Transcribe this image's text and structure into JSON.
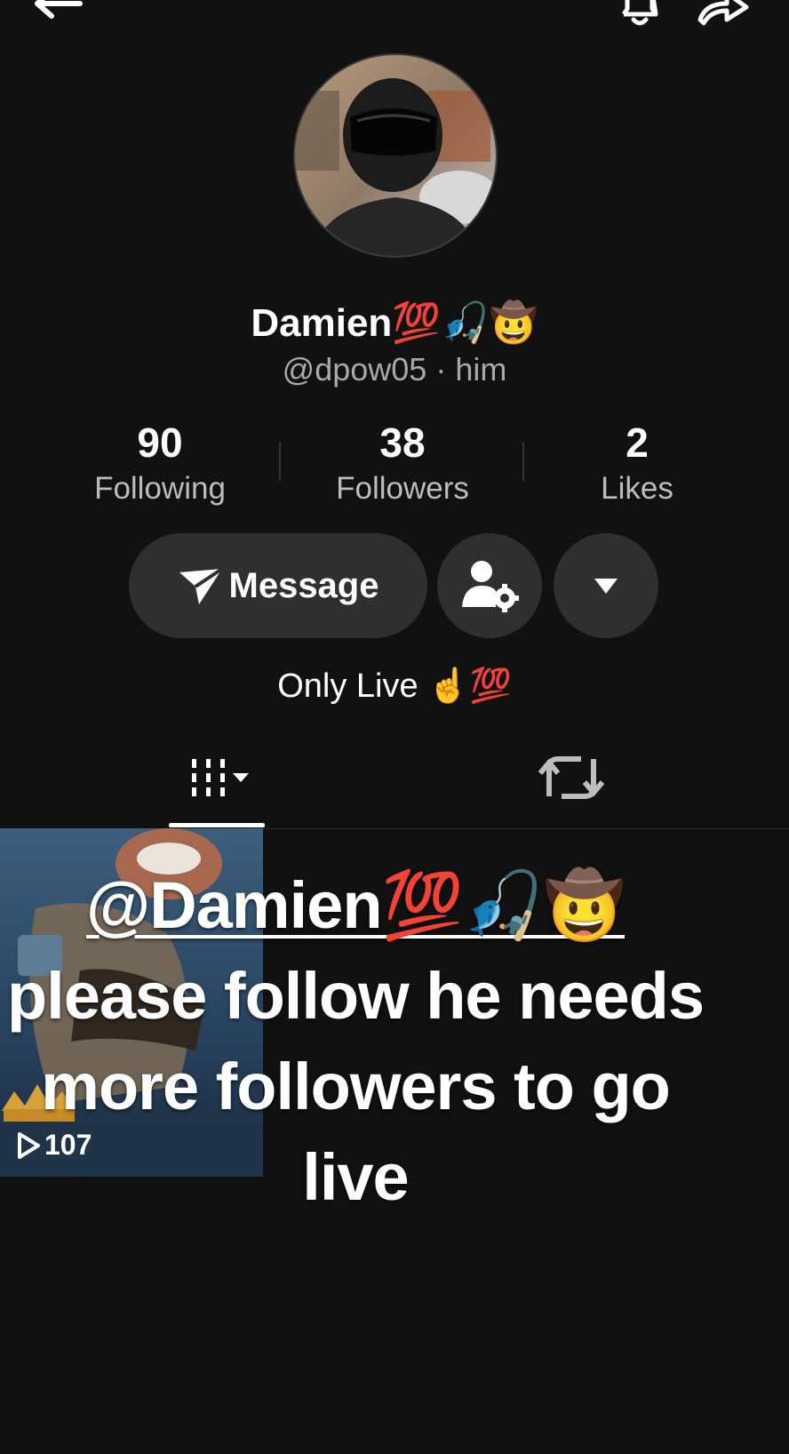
{
  "header": {
    "back_icon": "arrow-left-icon",
    "bell_icon": "bell-icon",
    "share_icon": "share-arrow-icon"
  },
  "profile": {
    "display_name": "Damien💯🎣🤠",
    "handle_line": "@dpow05 · him",
    "bio": "Only Live ☝️💯"
  },
  "stats": [
    {
      "value": "90",
      "label": "Following"
    },
    {
      "value": "38",
      "label": "Followers"
    },
    {
      "value": "2",
      "label": "Likes"
    }
  ],
  "actions": {
    "message_label": "Message",
    "message_icon": "paper-plane-icon",
    "profile_settings_icon": "person-gear-icon",
    "more_icon": "caret-down-icon"
  },
  "tabs": {
    "videos_icon": "video-grid-icon",
    "reposts_icon": "repost-icon"
  },
  "video": {
    "views": "107"
  },
  "overlay_text": {
    "mention": "@Damien💯🎣🤠",
    "line1": "please follow he needs",
    "line2": "more followers to go",
    "line3": "live"
  },
  "colors": {
    "background": "#111111",
    "button_bg": "#2f2f2f",
    "secondary_text": "#a8a8a8"
  }
}
